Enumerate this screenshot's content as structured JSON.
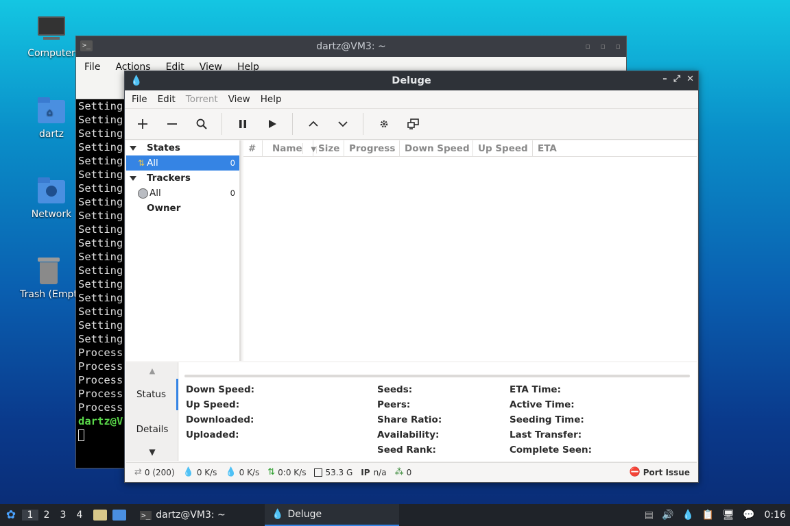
{
  "desktop": {
    "icons": [
      {
        "label": "Computer",
        "icon": "computer-icon"
      },
      {
        "label": "dartz",
        "icon": "home-folder-icon"
      },
      {
        "label": "Network",
        "icon": "network-folder-icon"
      },
      {
        "label": "Trash (Empt",
        "icon": "trash-icon"
      }
    ]
  },
  "terminal": {
    "title": "dartz@VM3: ~",
    "menu": [
      "File",
      "Actions",
      "Edit",
      "View",
      "Help"
    ],
    "lines": [
      "Setting",
      "Setting",
      "Setting",
      "Setting",
      "Setting",
      "Setting",
      "Setting",
      "Setting",
      "Setting",
      "Setting",
      "Setting",
      "Setting",
      "Setting",
      "Setting",
      "Setting",
      "Setting",
      "Setting",
      "Setting",
      "Process",
      "Process",
      "Process",
      "Process",
      "Process"
    ],
    "prompt": "dartz@V"
  },
  "deluge": {
    "title": "Deluge",
    "menu": [
      {
        "label": "File",
        "enabled": true
      },
      {
        "label": "Edit",
        "enabled": true
      },
      {
        "label": "Torrent",
        "enabled": false
      },
      {
        "label": "View",
        "enabled": true
      },
      {
        "label": "Help",
        "enabled": true
      }
    ],
    "toolbar": {
      "icons": [
        "add-icon",
        "remove-icon",
        "search-icon",
        "pause-icon",
        "play-icon",
        "queue-up-icon",
        "queue-down-icon",
        "preferences-gear-icon",
        "connection-manager-icon"
      ]
    },
    "sidebar": {
      "states_header": "States",
      "states": [
        {
          "label": "All",
          "count": "0",
          "selected": true
        }
      ],
      "trackers_header": "Trackers",
      "trackers": [
        {
          "label": "All",
          "count": "0"
        }
      ],
      "owner_header": "Owner"
    },
    "columns": [
      "#",
      "Name",
      "Size",
      "Progress",
      "Down Speed",
      "Up Speed",
      "ETA"
    ],
    "tabs": [
      "Status",
      "Details"
    ],
    "status_labels": {
      "col1": [
        "Down Speed:",
        "Up Speed:",
        "Downloaded:",
        "Uploaded:"
      ],
      "col2": [
        "Seeds:",
        "Peers:",
        "Share Ratio:",
        "Availability:",
        "Seed Rank:"
      ],
      "col3": [
        "ETA Time:",
        "Active Time:",
        "Seeding Time:",
        "Last Transfer:",
        "Complete Seen:"
      ]
    },
    "statusbar": {
      "connections": "0 (200)",
      "download": "0 K/s",
      "upload": "0 K/s",
      "protocol": "0:0 K/s",
      "disk": "53.3 G",
      "ip_label": "IP",
      "ip_value": "n/a",
      "dht": "0",
      "port_issue": "Port Issue"
    }
  },
  "taskbar": {
    "workspaces": [
      "1",
      "2",
      "3",
      "4"
    ],
    "tasks": [
      {
        "label": "dartz@VM3: ~",
        "active": false
      },
      {
        "label": "Deluge",
        "active": true
      }
    ],
    "clock": "0:16"
  },
  "colors": {
    "accent": "#3584e4",
    "titlebar": "#2e3238",
    "terminal_prompt": "#5ad84a"
  }
}
